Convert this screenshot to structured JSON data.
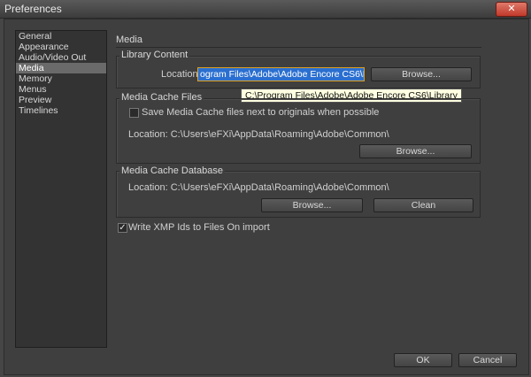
{
  "window": {
    "title": "Preferences",
    "close_label": "✕"
  },
  "sidebar": {
    "items": [
      {
        "label": "General"
      },
      {
        "label": "Appearance"
      },
      {
        "label": "Audio/Video Out"
      },
      {
        "label": "Media"
      },
      {
        "label": "Memory"
      },
      {
        "label": "Menus"
      },
      {
        "label": "Preview"
      },
      {
        "label": "Timelines"
      }
    ],
    "selected": "Media"
  },
  "section_title": "Media",
  "library": {
    "title": "Library Content",
    "location_label": "Location:",
    "path_value": "ogram Files\\Adobe\\Adobe Encore CS6\\Library",
    "tooltip": "C:\\Program Files\\Adobe\\Adobe Encore CS6\\Library",
    "browse_label": "Browse..."
  },
  "cache_files": {
    "title": "Media Cache Files",
    "checkbox_label": "Save Media Cache files next to originals when possible",
    "checkbox_checked": false,
    "location_text": "Location:  C:\\Users\\eFXi\\AppData\\Roaming\\Adobe\\Common\\",
    "browse_label": "Browse..."
  },
  "cache_db": {
    "title": "Media Cache Database",
    "location_text": "Location:  C:\\Users\\eFXi\\AppData\\Roaming\\Adobe\\Common\\",
    "browse_label": "Browse...",
    "clean_label": "Clean"
  },
  "xmp": {
    "label": "Write XMP Ids to Files On import",
    "checked": true,
    "check_mark": "✓"
  },
  "footer": {
    "ok_label": "OK",
    "cancel_label": "Cancel"
  }
}
